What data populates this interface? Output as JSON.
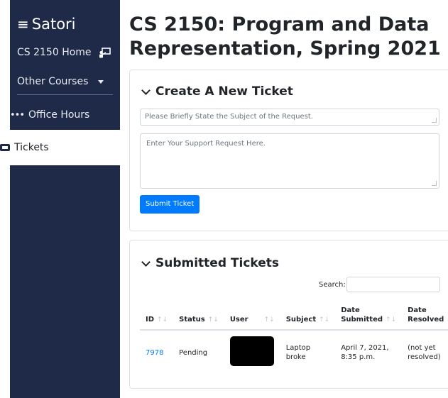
{
  "sidebar": {
    "brand": "Satori",
    "brand_icon": "hamburger-icon",
    "home_label": "CS 2150 Home",
    "home_icon": "chalkboard-teacher-icon",
    "other_courses_label": "Other Courses",
    "office_hours_label": "Office Hours",
    "office_hours_icon": "ellipsis-icon",
    "tickets_label": "Tickets",
    "tickets_icon": "ticket-icon"
  },
  "header": {
    "title": "CS 2150: Program and Data Representation, Spring 2021"
  },
  "create_ticket": {
    "title": "Create A New Ticket",
    "subject_placeholder": "Please Briefly State the Subject of the Request.",
    "request_placeholder": "Enter Your Support Request Here.",
    "submit_label": "Submit Ticket"
  },
  "submitted": {
    "title": "Submitted Tickets",
    "search_label": "Search:",
    "columns": [
      "ID",
      "Status",
      "User",
      "Subject",
      "Date Submitted",
      "Date Resolved"
    ],
    "rows": [
      {
        "id": "7978",
        "status": "Pending",
        "user": "",
        "subject": "Laptop broke",
        "date_submitted": "April 7, 2021, 8:35 p.m.",
        "date_resolved": "(not yet resolved)"
      }
    ]
  },
  "colors": {
    "sidebar_bg": "#1e2a47",
    "accent": "#007bff"
  }
}
